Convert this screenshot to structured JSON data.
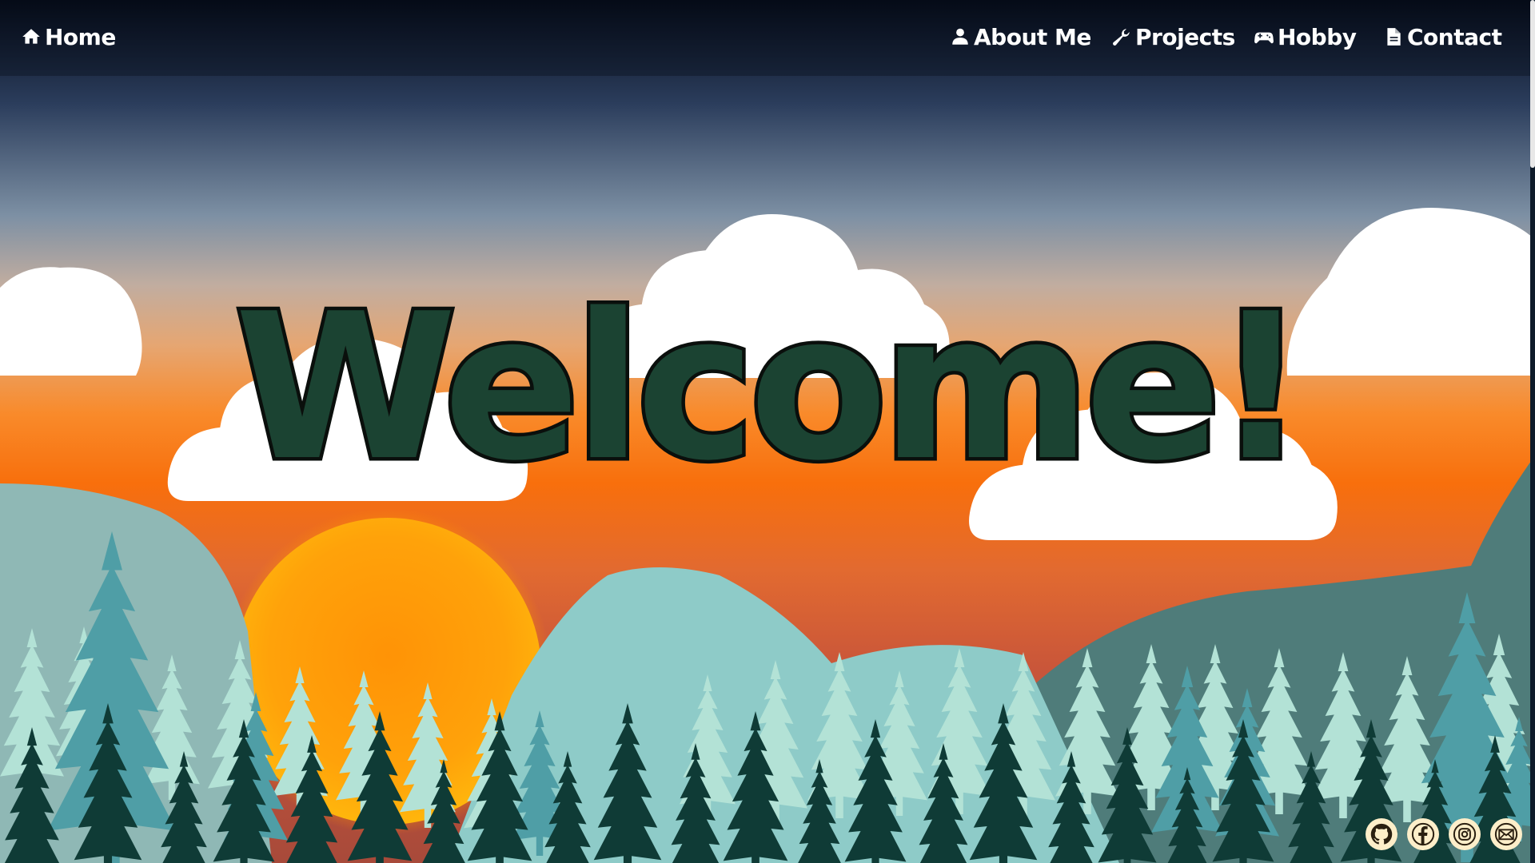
{
  "nav": {
    "home_label": "Home",
    "about_label": "About Me",
    "projects_label": "Projects",
    "hobby_label": "Hobby",
    "contact_label": "Contact",
    "icons": {
      "home": "home-icon",
      "about": "person-icon",
      "projects": "wrench-icon",
      "hobby": "gamepad-icon",
      "contact": "document-icon"
    }
  },
  "hero": {
    "title": "Welcome!"
  },
  "social": {
    "icons": [
      "github-icon",
      "facebook-icon",
      "instagram-icon",
      "email-icon"
    ]
  },
  "colors": {
    "sky_top": "#050b18",
    "sky_mid": "#3b5577",
    "sky_horizon": "#f97a10",
    "sun": "#ffa20a",
    "title_fill": "#1b4332",
    "title_stroke": "#0a0f0c",
    "social_bg": "#fdeec9",
    "far_trees": "#8cc7c2",
    "dark_trees": "#0e3a35"
  }
}
